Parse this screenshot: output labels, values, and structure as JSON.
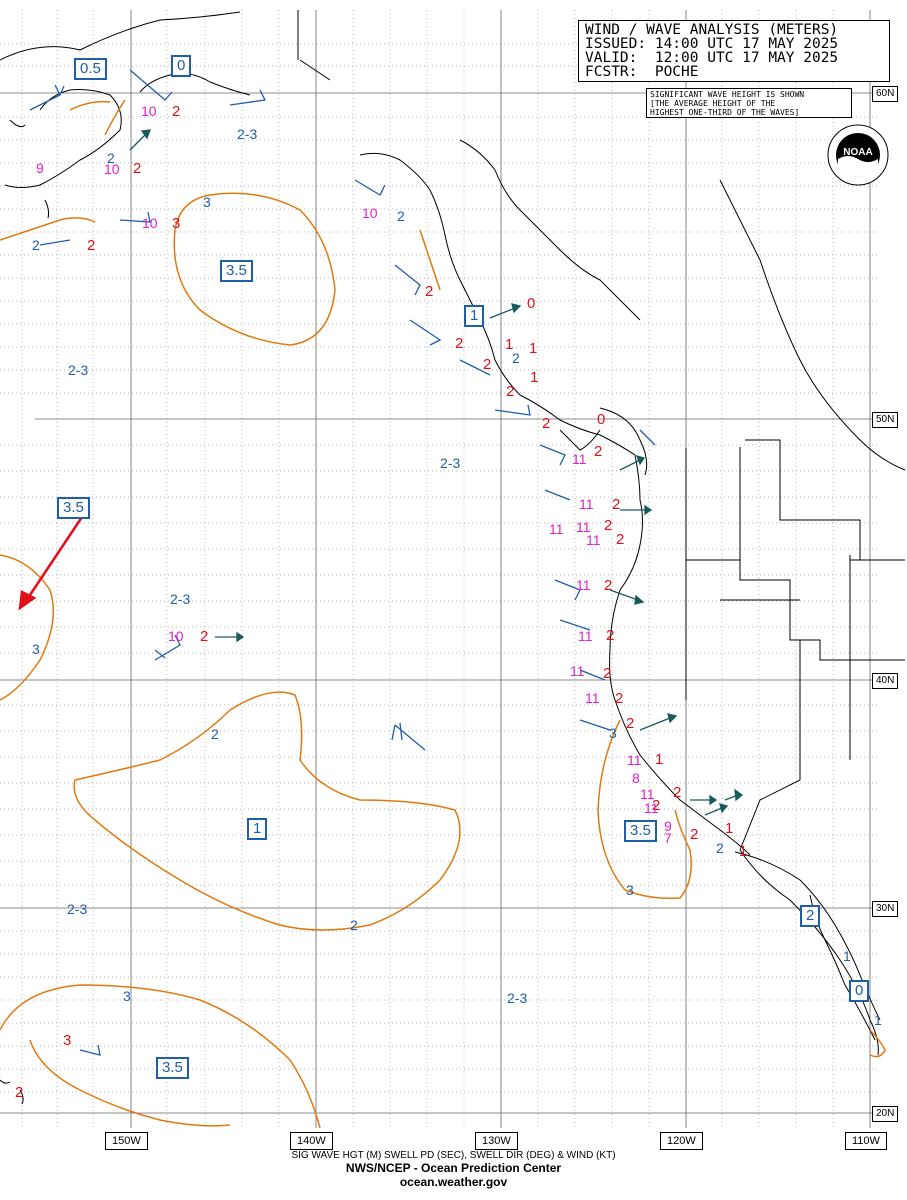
{
  "header": {
    "line1": "WIND / WAVE ANALYSIS (METERS)",
    "line2": "ISSUED: 14:00 UTC 17 MAY 2025",
    "line3": "VALID:  12:00 UTC 17 MAY 2025",
    "line4": "FCSTR:  POCHE"
  },
  "note": {
    "line1": "SIGNIFICANT WAVE HEIGHT IS SHOWN",
    "line2": "[THE AVERAGE HEIGHT OF THE",
    "line3": "HIGHEST ONE-THIRD OF THE WAVES]"
  },
  "logo": {
    "text": "NOAA",
    "icon": "noaa-seal-icon"
  },
  "longitude_labels": [
    "150W",
    "140W",
    "130W",
    "120W",
    "110W"
  ],
  "latitude_labels": [
    "60N",
    "50N",
    "40N",
    "30N",
    "20N"
  ],
  "footer": {
    "legend": "SIG WAVE HGT (M) SWELL PD (SEC), SWELL DIR (DEG) & WIND (KT)",
    "center": "NWS/NCEP - Ocean Prediction Center",
    "site": "ocean.weather.gov"
  },
  "boxed_wave_labels": [
    "0.5",
    "0",
    "3.5",
    "1",
    "3.5",
    "1",
    "3.5",
    "3.5",
    "2",
    "0"
  ],
  "range_labels": [
    "2-3",
    "2-3",
    "2-3",
    "2-3",
    "2-3",
    "2-3"
  ],
  "contour_labels": [
    "3",
    "3",
    "2",
    "2",
    "3",
    "3",
    "1",
    "1"
  ],
  "obs_heights": [
    "2",
    "2",
    "2",
    "3",
    "2",
    "2",
    "2",
    "0",
    "1",
    "1",
    "2",
    "2",
    "0",
    "1",
    "2",
    "2",
    "2",
    "2",
    "2",
    "2",
    "2",
    "2",
    "2",
    "1",
    "2",
    "2",
    "2",
    "2",
    "1",
    "1",
    "3",
    "2"
  ],
  "obs_periods": [
    "10",
    "10",
    "9",
    "10",
    "10",
    "10",
    "11",
    "11",
    "11",
    "11",
    "11",
    "11",
    "11",
    "11",
    "11",
    "11",
    "8",
    "11",
    "11",
    "9",
    "7"
  ],
  "colors": {
    "coast": "#000000",
    "grid": "#000000",
    "contour": "#e07a10",
    "wave_label": "#1f5ea8",
    "wave_height": "#e0101a",
    "swell_period": "#e020d0",
    "swell_arrow": "#1a5a5a",
    "arrow": "#e0101a"
  }
}
